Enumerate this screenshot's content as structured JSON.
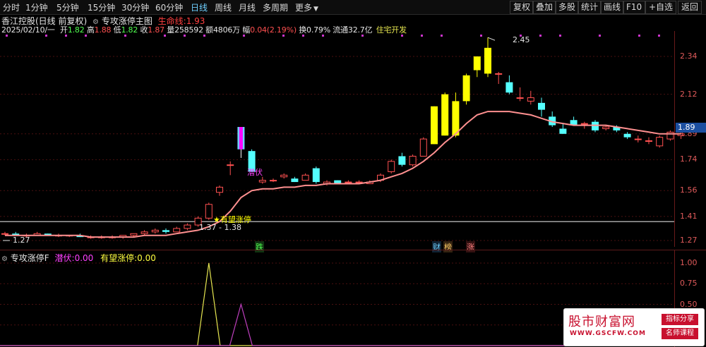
{
  "toolbar": {
    "left_items": [
      {
        "label": "分时",
        "active": false
      },
      {
        "label": "1分钟",
        "active": false
      },
      {
        "label": "5分钟",
        "active": false
      },
      {
        "label": "15分钟",
        "active": false
      },
      {
        "label": "30分钟",
        "active": false
      },
      {
        "label": "60分钟",
        "active": false
      },
      {
        "label": "日线",
        "active": true
      },
      {
        "label": "周线",
        "active": false
      },
      {
        "label": "月线",
        "active": false
      },
      {
        "label": "多周期",
        "active": false
      },
      {
        "label": "更多",
        "active": false
      }
    ],
    "right_items": [
      "复权",
      "叠加",
      "多股",
      "统计",
      "画线",
      "F10",
      "+自选",
      "返回"
    ]
  },
  "header": {
    "stock_name": "香江控股(日线 前复权)",
    "main_indicator": "专攻涨停主图",
    "lifeline_label": "生命线:",
    "lifeline_value": "1.93"
  },
  "quote": {
    "date": "2025/02/10/一",
    "open_label": "开",
    "open": "1.82",
    "high_label": "高",
    "high": "1.88",
    "low_label": "低",
    "low": "1.82",
    "close_label": "收",
    "close": "1.87",
    "vol_label": "量",
    "vol": "258592",
    "amt_label": "额",
    "amt": "4806万",
    "chg_label": "幅",
    "chg": "0.04(2.19%)",
    "turn_label": "换",
    "turn": "0.79%",
    "float_label": "流通",
    "float": "32.7亿",
    "sector": "住宅开发"
  },
  "chart_data": {
    "type": "candlestick",
    "y_ticks": [
      "2.34",
      "2.12",
      "1.89",
      "1.74",
      "1.56",
      "1.41",
      "1.27"
    ],
    "ylim": [
      1.24,
      2.5
    ],
    "current_price": "1.89",
    "high_annotation": "2.45",
    "low_annotation": "1.27",
    "range_annotation": "1.37 - 1.38",
    "signal_labels": {
      "qianfu": "潜伏",
      "youwang": "有望涨停"
    },
    "event_markers": [
      "跌",
      "财",
      "榜",
      "涨"
    ],
    "reference_price": 1.38,
    "candles": [
      [
        1.31,
        1.32,
        1.3,
        1.31
      ],
      [
        1.31,
        1.32,
        1.3,
        1.3
      ],
      [
        1.3,
        1.31,
        1.29,
        1.3
      ],
      [
        1.3,
        1.32,
        1.3,
        1.31
      ],
      [
        1.31,
        1.31,
        1.3,
        1.3
      ],
      [
        1.3,
        1.31,
        1.29,
        1.3
      ],
      [
        1.3,
        1.3,
        1.29,
        1.3
      ],
      [
        1.3,
        1.31,
        1.29,
        1.29
      ],
      [
        1.29,
        1.3,
        1.28,
        1.29
      ],
      [
        1.29,
        1.3,
        1.28,
        1.29
      ],
      [
        1.29,
        1.3,
        1.28,
        1.29
      ],
      [
        1.29,
        1.3,
        1.28,
        1.3
      ],
      [
        1.3,
        1.31,
        1.29,
        1.31
      ],
      [
        1.31,
        1.33,
        1.3,
        1.32
      ],
      [
        1.32,
        1.34,
        1.31,
        1.33
      ],
      [
        1.33,
        1.34,
        1.31,
        1.32
      ],
      [
        1.32,
        1.35,
        1.32,
        1.34
      ],
      [
        1.34,
        1.37,
        1.33,
        1.36
      ],
      [
        1.36,
        1.41,
        1.35,
        1.4
      ],
      [
        1.4,
        1.49,
        1.39,
        1.48
      ],
      [
        1.55,
        1.59,
        1.53,
        1.58
      ],
      [
        1.71,
        1.73,
        1.65,
        1.71
      ],
      [
        1.93,
        1.93,
        1.75,
        1.8
      ],
      [
        1.79,
        1.8,
        1.67,
        1.67
      ],
      [
        1.61,
        1.64,
        1.6,
        1.62
      ],
      [
        1.62,
        1.63,
        1.61,
        1.62
      ],
      [
        1.64,
        1.66,
        1.63,
        1.65
      ],
      [
        1.63,
        1.64,
        1.61,
        1.61
      ],
      [
        1.62,
        1.66,
        1.62,
        1.65
      ],
      [
        1.69,
        1.7,
        1.6,
        1.61
      ],
      [
        1.6,
        1.62,
        1.59,
        1.61
      ],
      [
        1.62,
        1.62,
        1.6,
        1.6
      ],
      [
        1.61,
        1.62,
        1.6,
        1.61
      ],
      [
        1.61,
        1.62,
        1.6,
        1.61
      ],
      [
        1.6,
        1.62,
        1.6,
        1.61
      ],
      [
        1.62,
        1.66,
        1.61,
        1.65
      ],
      [
        1.67,
        1.74,
        1.66,
        1.73
      ],
      [
        1.76,
        1.78,
        1.7,
        1.71
      ],
      [
        1.71,
        1.77,
        1.7,
        1.76
      ],
      [
        1.76,
        1.87,
        1.76,
        1.86
      ],
      [
        1.83,
        2.05,
        1.83,
        2.05
      ],
      [
        1.88,
        2.13,
        1.88,
        2.12
      ],
      [
        1.88,
        2.13,
        1.87,
        2.08
      ],
      [
        2.08,
        2.24,
        2.06,
        2.23
      ],
      [
        2.26,
        2.34,
        2.22,
        2.34
      ],
      [
        2.24,
        2.45,
        2.22,
        2.39
      ],
      [
        2.24,
        2.25,
        2.18,
        2.24
      ],
      [
        2.19,
        2.23,
        2.12,
        2.13
      ],
      [
        2.1,
        2.16,
        2.08,
        2.1
      ],
      [
        2.08,
        2.14,
        2.06,
        2.1
      ],
      [
        2.07,
        2.1,
        1.99,
        2.03
      ],
      [
        1.99,
        2.02,
        1.93,
        1.94
      ],
      [
        1.92,
        1.95,
        1.89,
        1.89
      ],
      [
        1.97,
        1.99,
        1.94,
        1.94
      ],
      [
        1.95,
        1.96,
        1.92,
        1.95
      ],
      [
        1.96,
        1.97,
        1.9,
        1.91
      ],
      [
        1.92,
        1.94,
        1.91,
        1.93
      ],
      [
        1.93,
        1.94,
        1.9,
        1.91
      ],
      [
        1.89,
        1.9,
        1.86,
        1.87
      ],
      [
        1.86,
        1.88,
        1.84,
        1.86
      ],
      [
        1.85,
        1.87,
        1.83,
        1.85
      ],
      [
        1.82,
        1.88,
        1.81,
        1.87
      ],
      [
        1.86,
        1.91,
        1.85,
        1.9
      ],
      [
        1.88,
        1.92,
        1.86,
        1.89
      ]
    ],
    "ma_line": [
      1.3,
      1.3,
      1.3,
      1.3,
      1.3,
      1.3,
      1.3,
      1.3,
      1.29,
      1.29,
      1.29,
      1.29,
      1.29,
      1.3,
      1.3,
      1.3,
      1.31,
      1.32,
      1.33,
      1.35,
      1.38,
      1.44,
      1.52,
      1.56,
      1.57,
      1.57,
      1.58,
      1.58,
      1.59,
      1.59,
      1.6,
      1.6,
      1.6,
      1.6,
      1.61,
      1.62,
      1.64,
      1.66,
      1.69,
      1.73,
      1.78,
      1.84,
      1.89,
      1.95,
      2.0,
      2.02,
      2.02,
      2.02,
      2.01,
      2.0,
      1.98,
      1.96,
      1.95,
      1.94,
      1.94,
      1.94,
      1.94,
      1.93,
      1.92,
      1.91,
      1.9,
      1.89,
      1.89,
      1.89
    ]
  },
  "indicator": {
    "name": "专攻涨停F",
    "qianfu_label": "潜伏:",
    "qianfu_value": "0.00",
    "youwang_label": "有望涨停:",
    "youwang_value": "0.00",
    "y_ticks": [
      "1.00",
      "0.75",
      "0.50",
      "0.25"
    ],
    "spikes": [
      {
        "color": "#e6e650",
        "peak": 1.0,
        "peak_index": 19
      },
      {
        "color": "#c040c0",
        "peak": 0.5,
        "peak_index": 22
      }
    ]
  },
  "watermark": {
    "brand": "股市财富网",
    "url": "WWW.GSCFW.COM",
    "tag1": "指标分享",
    "tag2": "名师课程"
  },
  "colors": {
    "up": "#ff5050",
    "down": "#54ffff",
    "limit_up": "#ffff00",
    "ma": "#ff9090",
    "signal_bar": "#ff00ff"
  }
}
